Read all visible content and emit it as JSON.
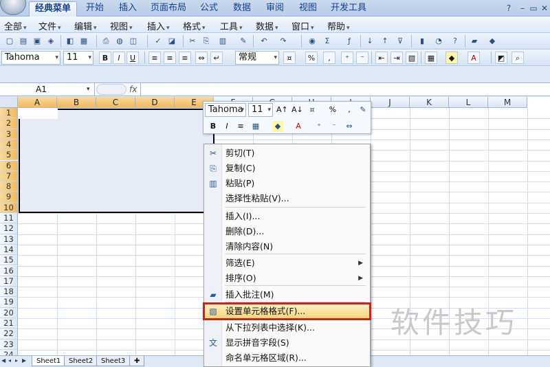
{
  "ribbon": {
    "tabs": [
      "经典菜单",
      "开始",
      "插入",
      "页面布局",
      "公式",
      "数据",
      "审阅",
      "视图",
      "开发工具"
    ],
    "help": "?",
    "minimize": "–",
    "restore": "▭",
    "close": "✕"
  },
  "menubar": {
    "items": [
      "全部",
      "文件",
      "编辑",
      "视图",
      "插入",
      "格式",
      "工具",
      "数据",
      "窗口",
      "帮助"
    ]
  },
  "format_toolbar": {
    "font": "Tahoma",
    "size": "11",
    "bold": "B",
    "italic": "I",
    "underline": "U",
    "number_format": "常规",
    "percent": "%",
    "comma": ","
  },
  "formula_bar": {
    "name_box": "A1",
    "fx": "fx"
  },
  "grid": {
    "columns": [
      "A",
      "B",
      "C",
      "D",
      "E",
      "F",
      "G",
      "H",
      "I",
      "J",
      "K",
      "L",
      "M"
    ],
    "rows": [
      "1",
      "2",
      "3",
      "4",
      "5",
      "6",
      "7",
      "8",
      "9",
      "10",
      "11",
      "12",
      "13",
      "14",
      "15",
      "16",
      "17",
      "18",
      "19",
      "20",
      "21",
      "22",
      "23",
      "24"
    ]
  },
  "sheets": [
    "Sheet1",
    "Sheet2",
    "Sheet3"
  ],
  "mini_toolbar": {
    "font": "Tahoma",
    "size": "11",
    "bold": "B",
    "italic": "I",
    "percent": "%",
    "comma": ","
  },
  "context_menu": {
    "items": [
      {
        "label": "剪切(T)",
        "icon": "scissors-icon"
      },
      {
        "label": "复制(C)",
        "icon": "copy-icon"
      },
      {
        "label": "粘贴(P)",
        "icon": "paste-icon"
      },
      {
        "label": "选择性粘贴(V)...",
        "icon": ""
      },
      {
        "label": "插入(I)...",
        "icon": ""
      },
      {
        "label": "删除(D)...",
        "icon": ""
      },
      {
        "label": "清除内容(N)",
        "icon": ""
      },
      {
        "label": "筛选(E)",
        "icon": "",
        "submenu": true
      },
      {
        "label": "排序(O)",
        "icon": "",
        "submenu": true
      },
      {
        "label": "插入批注(M)",
        "icon": "comment-icon"
      },
      {
        "label": "设置单元格格式(F)...",
        "icon": "format-cells-icon",
        "highlighted": true
      },
      {
        "label": "从下拉列表中选择(K)...",
        "icon": ""
      },
      {
        "label": "显示拼音字段(S)",
        "icon": "phonetic-icon"
      },
      {
        "label": "命名单元格区域(R)...",
        "icon": ""
      }
    ]
  },
  "watermark": "软件技巧",
  "colors": {
    "highlight_border": "#c2261f",
    "selection_fill": "#e7ebf6",
    "header_selected": "#f1b95f"
  }
}
